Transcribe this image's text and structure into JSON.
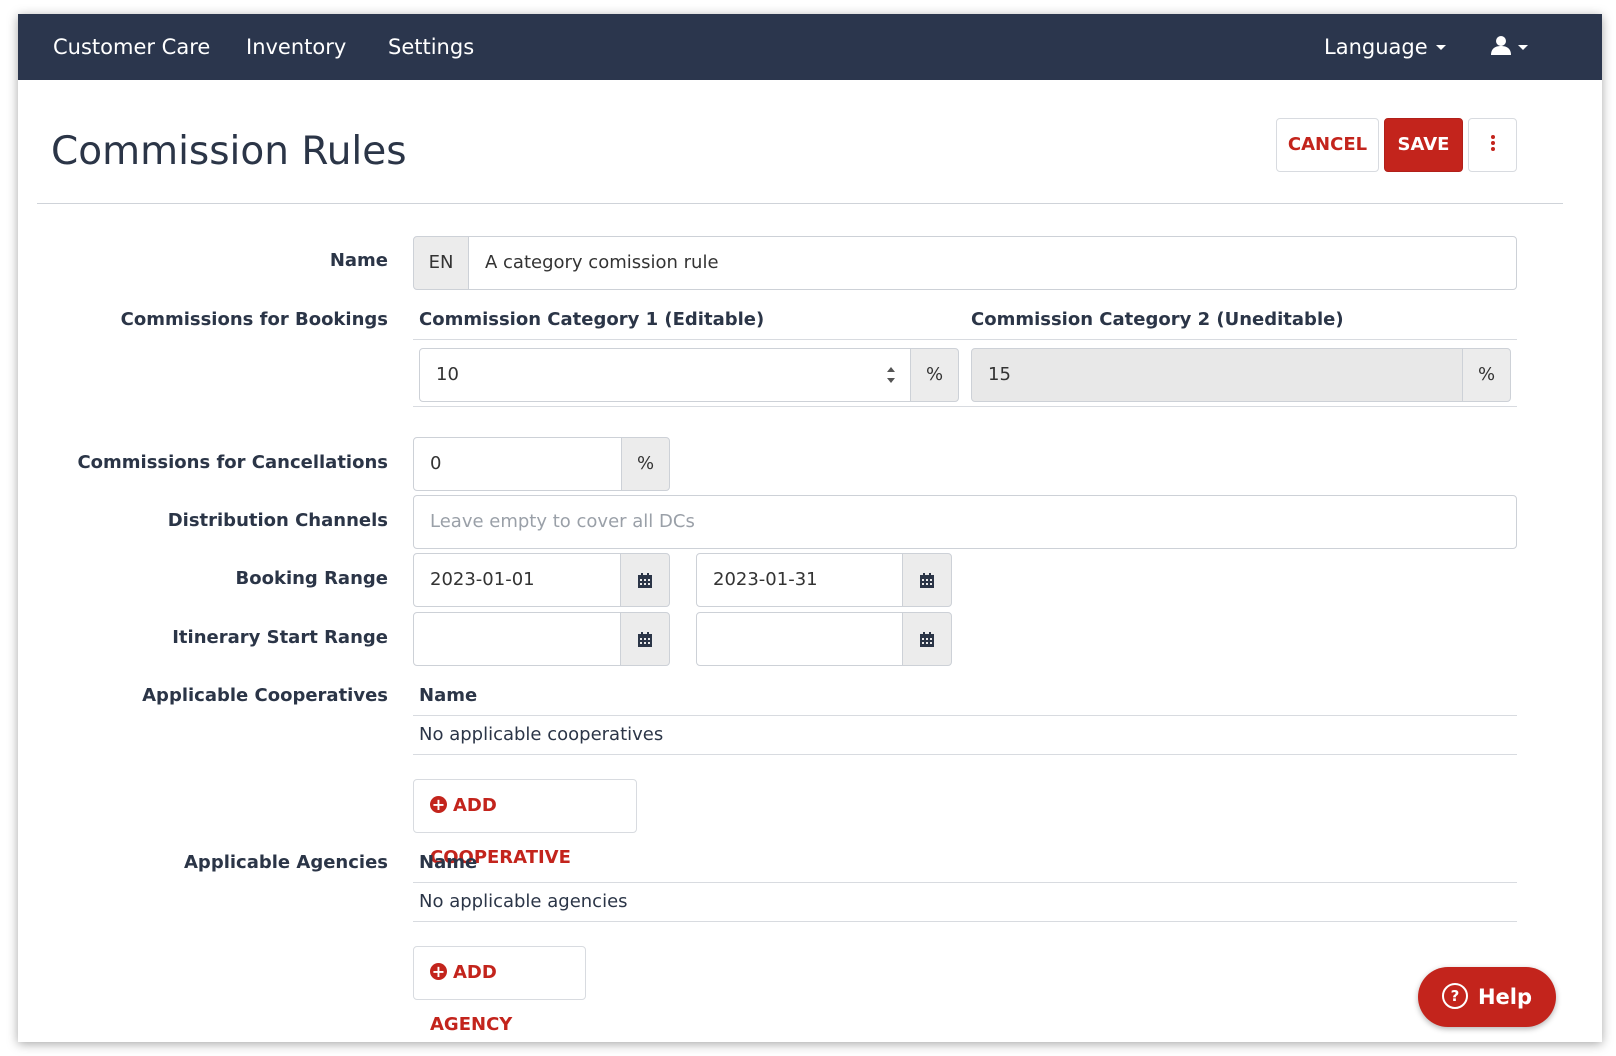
{
  "nav": {
    "items": [
      {
        "label": "Customer Care"
      },
      {
        "label": "Inventory"
      },
      {
        "label": "Settings"
      }
    ],
    "language_label": "Language",
    "user_icon": "user-icon"
  },
  "page": {
    "title": "Commission Rules",
    "cancel_label": "CANCEL",
    "save_label": "SAVE",
    "more_icon": "vertical-ellipsis-icon"
  },
  "form": {
    "name": {
      "label": "Name",
      "lang": "EN",
      "value": "A category comission rule"
    },
    "bookings": {
      "label": "Commissions for Bookings",
      "cat1_header": "Commission Category 1 (Editable)",
      "cat1_value": "10",
      "cat2_header": "Commission Category 2 (Uneditable)",
      "cat2_value": "15",
      "unit": "%"
    },
    "cancellations": {
      "label": "Commissions for Cancellations",
      "value": "0",
      "unit": "%"
    },
    "channels": {
      "label": "Distribution Channels",
      "placeholder": "Leave empty to cover all DCs"
    },
    "booking_range": {
      "label": "Booking Range",
      "from": "2023-01-01",
      "to": "2023-01-31"
    },
    "itinerary_range": {
      "label": "Itinerary Start Range",
      "from": "",
      "to": ""
    },
    "cooperatives": {
      "label": "Applicable Cooperatives",
      "column": "Name",
      "empty": "No applicable cooperatives",
      "add_label": "ADD COOPERATIVE"
    },
    "agencies": {
      "label": "Applicable Agencies",
      "column": "Name",
      "empty": "No applicable agencies",
      "add_label": "ADD AGENCY"
    }
  },
  "help": {
    "label": "Help"
  },
  "colors": {
    "navbar": "#2b364d",
    "accent": "#c3241c",
    "text": "#2b3547"
  }
}
